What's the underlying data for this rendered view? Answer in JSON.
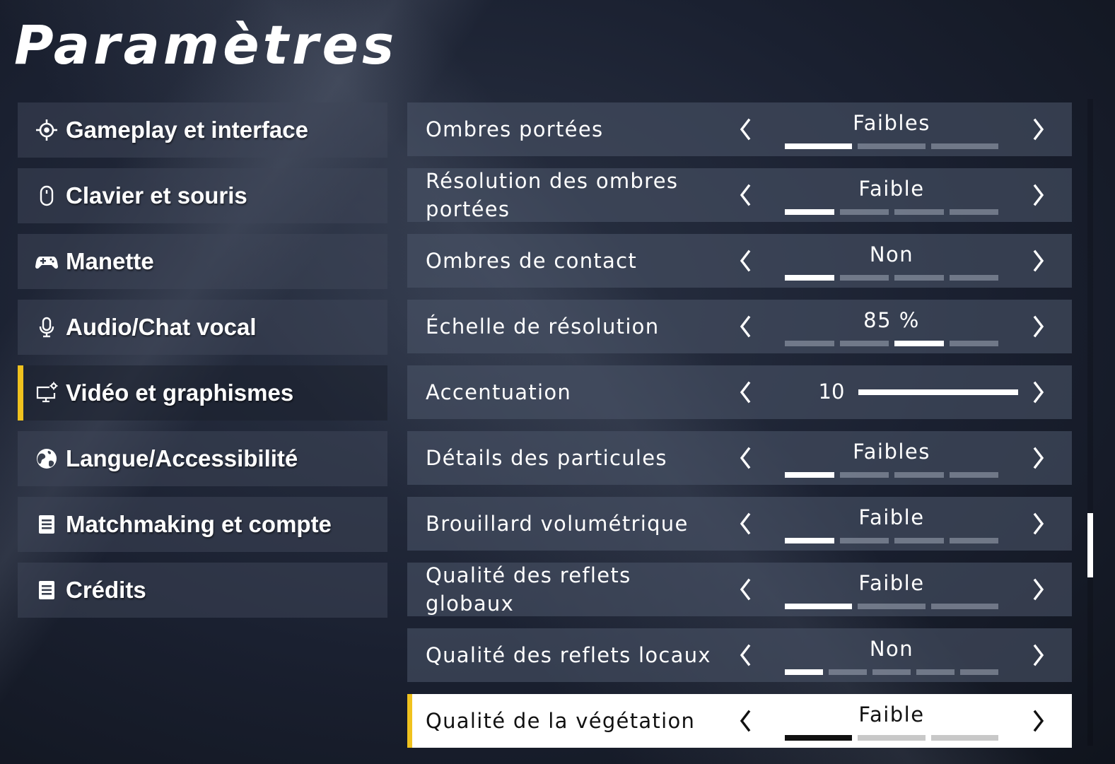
{
  "page_title": "Paramètres",
  "colors": {
    "accent": "#f0c21e"
  },
  "sidebar": {
    "items": [
      {
        "label": "Gameplay et interface",
        "icon": "crosshair-icon",
        "active": false
      },
      {
        "label": "Clavier et souris",
        "icon": "mouse-icon",
        "active": false
      },
      {
        "label": "Manette",
        "icon": "gamepad-icon",
        "active": false
      },
      {
        "label": "Audio/Chat vocal",
        "icon": "microphone-icon",
        "active": false
      },
      {
        "label": "Vidéo et graphismes",
        "icon": "monitor-gear-icon",
        "active": true
      },
      {
        "label": "Langue/Accessibilité",
        "icon": "globe-icon",
        "active": false
      },
      {
        "label": "Matchmaking et compte",
        "icon": "document-icon",
        "active": false
      },
      {
        "label": "Crédits",
        "icon": "document-icon",
        "active": false
      }
    ]
  },
  "settings": [
    {
      "label": "Ombres portées",
      "value": "Faibles",
      "segments": 3,
      "selected_index": 0
    },
    {
      "label": "Résolution des ombres portées",
      "value": "Faible",
      "segments": 4,
      "selected_index": 0
    },
    {
      "label": "Ombres de contact",
      "value": "Non",
      "segments": 4,
      "selected_index": 0
    },
    {
      "label": "Échelle de résolution",
      "value": "85 %",
      "segments": 4,
      "selected_index": 2
    },
    {
      "label": "Accentuation",
      "value": "10",
      "type": "slider",
      "slider_fraction": 1.0
    },
    {
      "label": "Détails des particules",
      "value": "Faibles",
      "segments": 4,
      "selected_index": 0
    },
    {
      "label": "Brouillard volumétrique",
      "value": "Faible",
      "segments": 4,
      "selected_index": 0
    },
    {
      "label": "Qualité des reflets globaux",
      "value": "Faible",
      "segments": 3,
      "selected_index": 0
    },
    {
      "label": "Qualité des reflets locaux",
      "value": "Non",
      "segments": 5,
      "selected_index": 0
    },
    {
      "label": "Qualité de la végétation",
      "value": "Faible",
      "segments": 3,
      "selected_index": 0,
      "focused": true
    }
  ],
  "scrollbar": {
    "thumb_start_fraction": 0.64,
    "thumb_length_fraction": 0.1
  }
}
